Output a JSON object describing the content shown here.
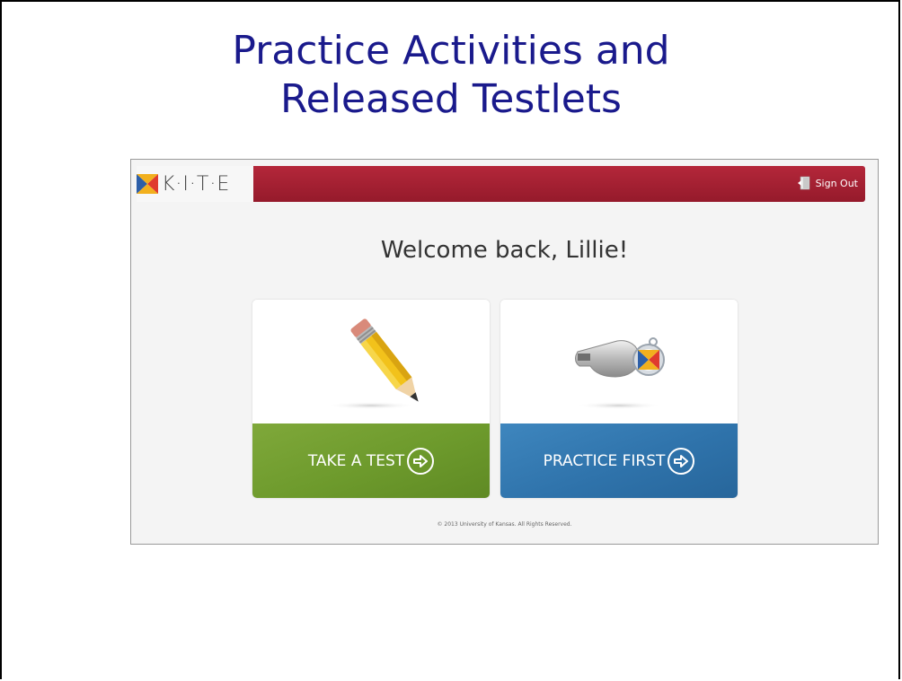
{
  "slide": {
    "title_line1": "Practice Activities and",
    "title_line2": "Released Testlets"
  },
  "app": {
    "logo_text": "K·I·T·E",
    "signout_label": "Sign Out",
    "welcome": "Welcome back, Lillie!",
    "cards": [
      {
        "label": "TAKE A TEST",
        "icon": "pencil-icon",
        "color": "#6d9a2c"
      },
      {
        "label": "PRACTICE FIRST",
        "icon": "whistle-icon",
        "color": "#2f73ab"
      }
    ],
    "copyright": "© 2013 University of Kansas. All Rights Reserved."
  },
  "colors": {
    "title": "#1a1a8c",
    "banner": "#a42033"
  }
}
